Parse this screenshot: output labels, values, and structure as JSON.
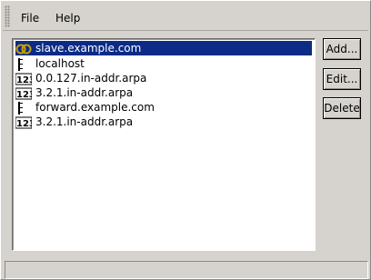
{
  "menubar": {
    "file_label": "File",
    "help_label": "Help"
  },
  "zones": [
    {
      "name": "slave.example.com",
      "icon": "slave-zone-icon",
      "selected": true
    },
    {
      "name": "localhost",
      "icon": "forward-zone-icon",
      "selected": false
    },
    {
      "name": "0.0.127.in-addr.arpa",
      "icon": "reverse-zone-icon",
      "selected": false
    },
    {
      "name": "3.2.1.in-addr.arpa",
      "icon": "reverse-zone-icon",
      "selected": false
    },
    {
      "name": "forward.example.com",
      "icon": "forward-zone-icon",
      "selected": false
    },
    {
      "name": "3.2.1.in-addr.arpa",
      "icon": "reverse-zone-icon",
      "selected": false
    }
  ],
  "buttons": {
    "add_label": "Add...",
    "edit_label": "Edit...",
    "delete_label": "Delete"
  },
  "colors": {
    "selection": "#0b2b86",
    "background": "#d6d3ce"
  }
}
